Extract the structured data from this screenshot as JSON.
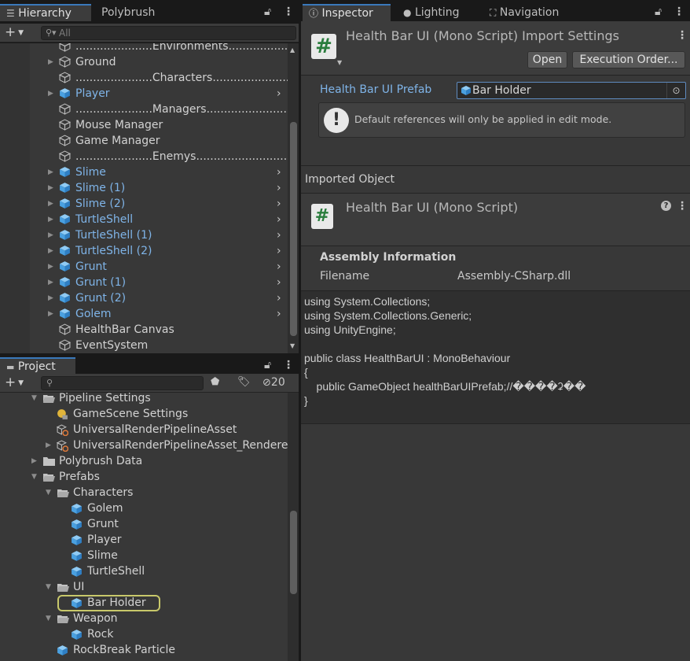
{
  "hierarchy": {
    "tabs": [
      "Hierarchy",
      "Polybrush"
    ],
    "search_placeholder": "All",
    "add_label": "+",
    "items": [
      {
        "label": "......................Environments.....................",
        "kind": "gameobject",
        "fold": false,
        "chevron": false,
        "indent": 0
      },
      {
        "label": "Ground",
        "kind": "gameobject",
        "fold": true,
        "chevron": false,
        "indent": 0
      },
      {
        "label": "......................Characters......................",
        "kind": "gameobject",
        "fold": false,
        "chevron": false,
        "indent": 0
      },
      {
        "label": "Player",
        "kind": "prefab",
        "fold": true,
        "chevron": true,
        "indent": 0
      },
      {
        "label": "......................Managers.......................",
        "kind": "gameobject",
        "fold": false,
        "chevron": false,
        "indent": 0
      },
      {
        "label": "Mouse Manager",
        "kind": "gameobject",
        "fold": false,
        "chevron": false,
        "indent": 0
      },
      {
        "label": "Game Manager",
        "kind": "gameobject",
        "fold": false,
        "chevron": false,
        "indent": 0
      },
      {
        "label": "......................Enemys..........................",
        "kind": "gameobject",
        "fold": false,
        "chevron": false,
        "indent": 0
      },
      {
        "label": "Slime",
        "kind": "prefab",
        "fold": true,
        "chevron": true,
        "indent": 0
      },
      {
        "label": "Slime (1)",
        "kind": "prefab",
        "fold": true,
        "chevron": true,
        "indent": 0
      },
      {
        "label": "Slime (2)",
        "kind": "prefab",
        "fold": true,
        "chevron": true,
        "indent": 0
      },
      {
        "label": "TurtleShell",
        "kind": "prefab",
        "fold": true,
        "chevron": true,
        "indent": 0
      },
      {
        "label": "TurtleShell (1)",
        "kind": "prefab",
        "fold": true,
        "chevron": true,
        "indent": 0
      },
      {
        "label": "TurtleShell (2)",
        "kind": "prefab",
        "fold": true,
        "chevron": true,
        "indent": 0
      },
      {
        "label": "Grunt",
        "kind": "prefab",
        "fold": true,
        "chevron": true,
        "indent": 0
      },
      {
        "label": "Grunt (1)",
        "kind": "prefab",
        "fold": true,
        "chevron": true,
        "indent": 0
      },
      {
        "label": "Grunt (2)",
        "kind": "prefab",
        "fold": true,
        "chevron": true,
        "indent": 0
      },
      {
        "label": "Golem",
        "kind": "prefab",
        "fold": true,
        "chevron": true,
        "indent": 0
      },
      {
        "label": "HealthBar Canvas",
        "kind": "gameobject",
        "fold": false,
        "chevron": false,
        "indent": 0
      },
      {
        "label": "EventSystem",
        "kind": "gameobject",
        "fold": false,
        "chevron": false,
        "indent": 0
      }
    ]
  },
  "project": {
    "tab": "Project",
    "hidden_count": "20",
    "add_label": "+",
    "items": [
      {
        "label": "Pipeline Settings",
        "kind": "folder-open",
        "fold": "open",
        "indent": 1
      },
      {
        "label": "GameScene Settings",
        "kind": "settings",
        "fold": "none",
        "indent": 2
      },
      {
        "label": "UniversalRenderPipelineAsset",
        "kind": "asset",
        "fold": "none",
        "indent": 2
      },
      {
        "label": "UniversalRenderPipelineAsset_Renderer",
        "kind": "asset",
        "fold": "closed",
        "indent": 2
      },
      {
        "label": "Polybrush Data",
        "kind": "folder",
        "fold": "closed",
        "indent": 1
      },
      {
        "label": "Prefabs",
        "kind": "folder-open",
        "fold": "open",
        "indent": 1
      },
      {
        "label": "Characters",
        "kind": "folder-open",
        "fold": "open",
        "indent": 2
      },
      {
        "label": "Golem",
        "kind": "prefab",
        "fold": "none",
        "indent": 3
      },
      {
        "label": "Grunt",
        "kind": "prefab",
        "fold": "none",
        "indent": 3
      },
      {
        "label": "Player",
        "kind": "prefab",
        "fold": "none",
        "indent": 3
      },
      {
        "label": "Slime",
        "kind": "prefab",
        "fold": "none",
        "indent": 3
      },
      {
        "label": "TurtleShell",
        "kind": "prefab",
        "fold": "none",
        "indent": 3
      },
      {
        "label": "UI",
        "kind": "folder-open",
        "fold": "open",
        "indent": 2
      },
      {
        "label": "Bar Holder",
        "kind": "prefab",
        "fold": "none",
        "indent": 3,
        "highlight": true
      },
      {
        "label": "Weapon",
        "kind": "folder-open",
        "fold": "open",
        "indent": 2
      },
      {
        "label": "Rock",
        "kind": "prefab",
        "fold": "none",
        "indent": 3
      },
      {
        "label": "RockBreak Particle",
        "kind": "prefab",
        "fold": "none",
        "indent": 2
      }
    ]
  },
  "inspector": {
    "tabs": [
      "Inspector",
      "Lighting",
      "Navigation"
    ],
    "title": "Health Bar UI (Mono Script) Import Settings",
    "open_label": "Open",
    "exec_order_label": "Execution Order...",
    "field_label": "Health Bar UI Prefab",
    "field_value": "Bar Holder",
    "help_text": "Default references will only be applied in edit mode.",
    "imported_object_label": "Imported Object",
    "script_title": "Health Bar UI (Mono Script)",
    "assembly_heading": "Assembly Information",
    "filename_label": "Filename",
    "filename_value": "Assembly-CSharp.dll",
    "code": "using System.Collections;\nusing System.Collections.Generic;\nusing UnityEngine;\n\npublic class HealthBarUI : MonoBehaviour\n{\n    public GameObject healthBarUIPrefab;//����ʡ��\n}"
  },
  "colors": {
    "prefab_blue": "#7fb4e8",
    "accent": "#3a79bb",
    "highlight_ring": "#c8c86a"
  }
}
